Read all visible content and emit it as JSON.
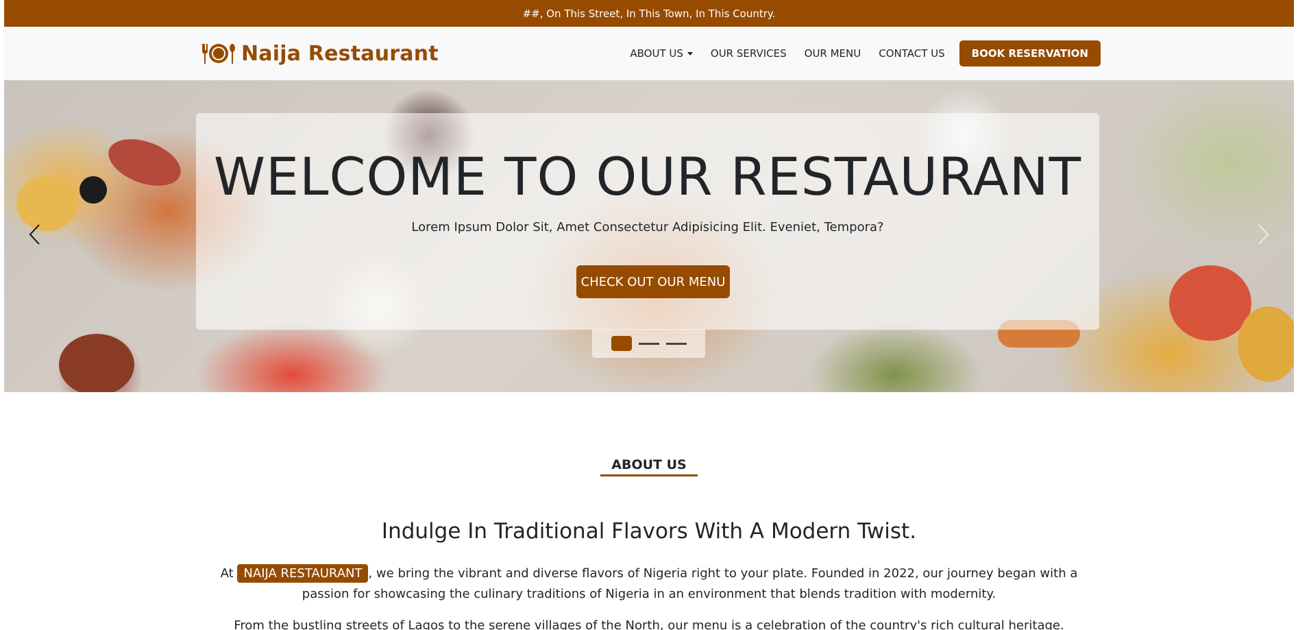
{
  "topbar": {
    "address": "##, On This Street, In This Town, In This Country."
  },
  "brand": {
    "name": "Naija Restaurant",
    "icon": "utensils-plate-icon"
  },
  "nav": {
    "items": [
      {
        "label": "ABOUT US",
        "has_dropdown": true
      },
      {
        "label": "OUR SERVICES"
      },
      {
        "label": "OUR MENU"
      },
      {
        "label": "CONTACT US"
      }
    ],
    "cta": "BOOK RESERVATION"
  },
  "hero": {
    "title": "WELCOME TO OUR RESTAURANT",
    "subtitle": "Lorem Ipsum Dolor Sit, Amet Consectetur Adipisicing Elit. Eveniet, Tempora?",
    "button": "CHECK OUT OUR MENU",
    "slides": 3,
    "active_slide": 1,
    "prev_icon": "chevron-left-icon",
    "next_icon": "chevron-right-icon"
  },
  "about": {
    "label": "ABOUT US",
    "heading": "Indulge In Traditional Flavors With A Modern Twist.",
    "p1_prefix": "At",
    "p1_highlight": "NAIJA RESTAURANT",
    "p1_rest": ", we bring the vibrant and diverse flavors of Nigeria right to your plate. Founded in 2022, our journey began with a passion for showcasing the culinary traditions of Nigeria in an environment that blends tradition with modernity.",
    "p2": "From the bustling streets of Lagos to the serene villages of the North, our menu is a celebration of the country's rich cultural heritage."
  },
  "colors": {
    "accent": "#964b00",
    "navbar_bg": "#f8f9fa",
    "text": "#212529"
  }
}
